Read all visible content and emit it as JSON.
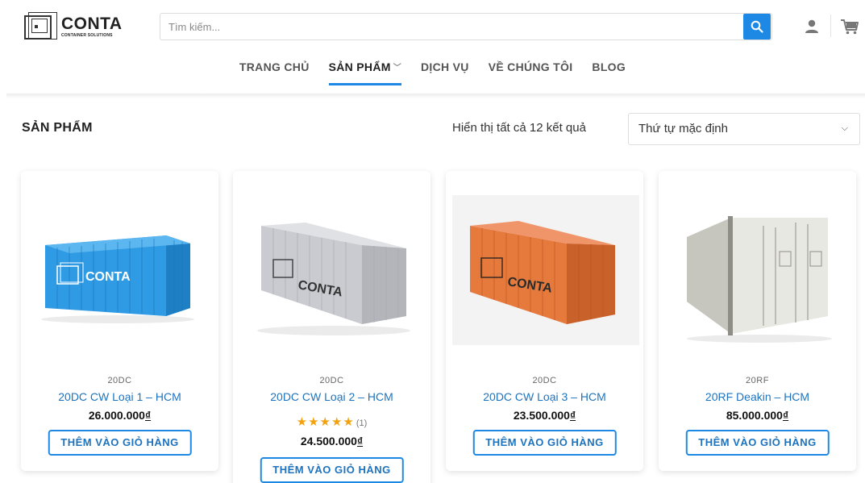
{
  "header": {
    "logo": {
      "name": "CONTA",
      "subtitle": "CONTAINER SOLUTIONS"
    },
    "search": {
      "placeholder": "Tìm kiếm..."
    },
    "icons": {
      "search": "search-icon",
      "account": "user-icon",
      "cart": "cart-icon"
    }
  },
  "nav": {
    "items": [
      {
        "label": "TRANG CHỦ"
      },
      {
        "label": "SẢN PHẨM",
        "active": true,
        "has_dropdown": true
      },
      {
        "label": "DỊCH VỤ"
      },
      {
        "label": "VỀ CHÚNG TÔI"
      },
      {
        "label": "BLOG"
      }
    ]
  },
  "shop": {
    "title": "SẢN PHẨM",
    "result_count": "Hiển thị tất cả 12 kết quả",
    "orderby_selected": "Thứ tự mặc định"
  },
  "products": [
    {
      "category": "20DC",
      "name": "20DC CW Loại 1 – HCM",
      "price": "26.000.000",
      "currency": "₫",
      "button": "THÊM VÀO GIỎ HÀNG",
      "container_color": "#2f9be4",
      "branding": "CONTA"
    },
    {
      "category": "20DC",
      "name": "20DC CW Loại 2 – HCM",
      "price": "24.500.000",
      "currency": "₫",
      "button": "THÊM VÀO GIỎ HÀNG",
      "rating": {
        "stars": "★★★★★",
        "count": "(1)",
        "value": 5
      },
      "container_color": "#c9cbd0",
      "branding": "CONTA"
    },
    {
      "category": "20DC",
      "name": "20DC CW Loại 3 – HCM",
      "price": "23.500.000",
      "currency": "₫",
      "button": "THÊM VÀO GIỎ HÀNG",
      "container_color": "#e67a3c",
      "branding": "CONTA"
    },
    {
      "category": "20RF",
      "name": "20RF Deakin – HCM",
      "price": "85.000.000",
      "currency": "₫",
      "button": "THÊM VÀO GIỎ HÀNG",
      "container_color": "#dcdcd4"
    }
  ],
  "colors": {
    "accent": "#1e88e5",
    "link": "#1e73be",
    "star": "#f2a30f"
  }
}
